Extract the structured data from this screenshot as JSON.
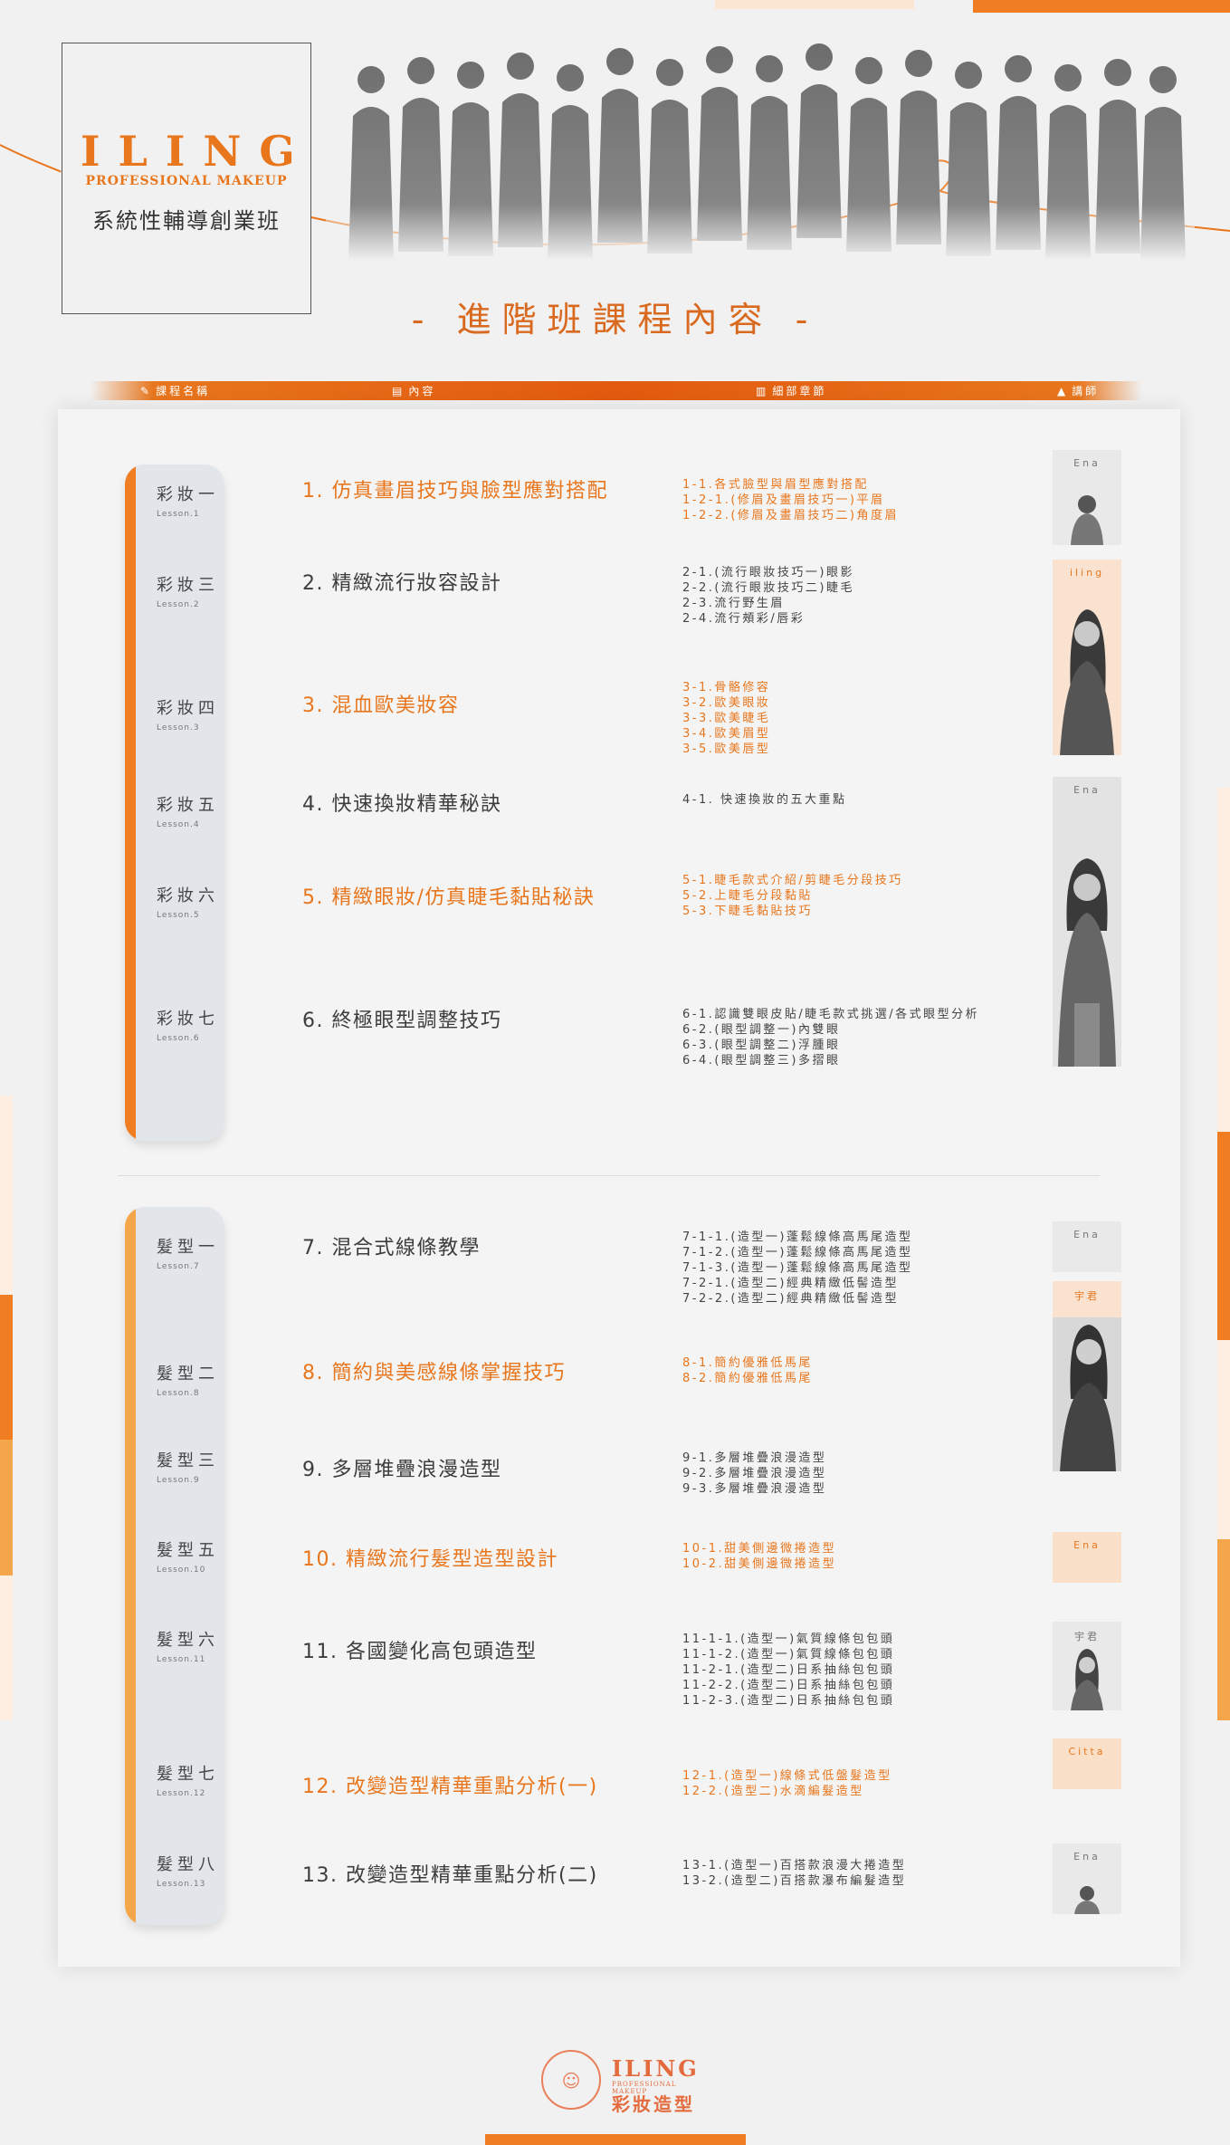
{
  "colors": {
    "accent": "#e8761d",
    "accent_light": "#f5a64a",
    "pill": "#e2e5ea"
  },
  "brand": {
    "name": "ILING",
    "tagline": "PROFESSIONAL MAKEUP",
    "course_line": "系統性輔導創業班"
  },
  "section_title": "- 進階班課程內容 -",
  "header": {
    "col_name": "課程名稱",
    "col_content": "內容",
    "col_chapters": "細部章節",
    "col_teacher": "講師"
  },
  "makeup": [
    {
      "lesson": "彩妝一",
      "lesson_en": "Lesson.1",
      "title": "1. 仿真畫眉技巧與臉型應對搭配",
      "highlight": true,
      "details": [
        "1-1.各式臉型與眉型應對搭配",
        "1-2-1.(修眉及畫眉技巧一)平眉",
        "1-2-2.(修眉及畫眉技巧二)角度眉"
      ]
    },
    {
      "lesson": "彩妝三",
      "lesson_en": "Lesson.2",
      "title": "2. 精緻流行妝容設計",
      "highlight": false,
      "details": [
        "2-1.(流行眼妝技巧一)眼影",
        "2-2.(流行眼妝技巧二)睫毛",
        "2-3.流行野生眉",
        "2-4.流行頰彩/唇彩"
      ]
    },
    {
      "lesson": "彩妝四",
      "lesson_en": "Lesson.3",
      "title": "3. 混血歐美妝容",
      "highlight": true,
      "details": [
        "3-1.骨骼修容",
        "3-2.歐美眼妝",
        "3-3.歐美睫毛",
        "3-4.歐美眉型",
        "3-5.歐美唇型"
      ]
    },
    {
      "lesson": "彩妝五",
      "lesson_en": "Lesson.4",
      "title": "4. 快速換妝精華秘訣",
      "highlight": false,
      "details": [
        "4-1. 快速換妝的五大重點"
      ]
    },
    {
      "lesson": "彩妝六",
      "lesson_en": "Lesson.5",
      "title": "5. 精緻眼妝/仿真睫毛黏貼秘訣",
      "highlight": true,
      "details": [
        "5-1.睫毛款式介紹/剪睫毛分段技巧",
        "5-2.上睫毛分段黏貼",
        "5-3.下睫毛黏貼技巧"
      ]
    },
    {
      "lesson": "彩妝七",
      "lesson_en": "Lesson.6",
      "title": "6. 終極眼型調整技巧",
      "highlight": false,
      "details": [
        "6-1.認識雙眼皮貼/睫毛款式挑選/各式眼型分析",
        "6-2.(眼型調整一)內雙眼",
        "6-3.(眼型調整二)浮腫眼",
        "6-4.(眼型調整三)多摺眼"
      ]
    }
  ],
  "hair": [
    {
      "lesson": "髮型一",
      "lesson_en": "Lesson.7",
      "title": "7. 混合式線條教學",
      "highlight": false,
      "details": [
        "7-1-1.(造型一)蓬鬆線條高馬尾造型",
        "7-1-2.(造型一)蓬鬆線條高馬尾造型",
        "7-1-3.(造型一)蓬鬆線條高馬尾造型",
        "7-2-1.(造型二)經典精緻低髻造型",
        "7-2-2.(造型二)經典精緻低髻造型"
      ]
    },
    {
      "lesson": "髮型二",
      "lesson_en": "Lesson.8",
      "title": "8. 簡約與美感線條掌握技巧",
      "highlight": true,
      "details": [
        "8-1.簡約優雅低馬尾",
        "8-2.簡約優雅低馬尾"
      ]
    },
    {
      "lesson": "髮型三",
      "lesson_en": "Lesson.9",
      "title": "9. 多層堆疊浪漫造型",
      "highlight": false,
      "details": [
        "9-1.多層堆疊浪漫造型",
        "9-2.多層堆疊浪漫造型",
        "9-3.多層堆疊浪漫造型"
      ]
    },
    {
      "lesson": "髮型五",
      "lesson_en": "Lesson.10",
      "title": "10. 精緻流行髮型造型設計",
      "highlight": true,
      "details": [
        "10-1.甜美側邊微捲造型",
        "10-2.甜美側邊微捲造型"
      ]
    },
    {
      "lesson": "髮型六",
      "lesson_en": "Lesson.11",
      "title": "11. 各國變化高包頭造型",
      "highlight": false,
      "details": [
        "11-1-1.(造型一)氣質線條包包頭",
        "11-1-2.(造型一)氣質線條包包頭",
        "11-2-1.(造型二)日系抽絲包包頭",
        "11-2-2.(造型二)日系抽絲包包頭",
        "11-2-3.(造型二)日系抽絲包包頭"
      ]
    },
    {
      "lesson": "髮型七",
      "lesson_en": "Lesson.12",
      "title": "12. 改變造型精華重點分析(一)",
      "highlight": true,
      "details": [
        "12-1.(造型一)線條式低盤髮造型",
        "12-2.(造型二)水滴編髮造型"
      ]
    },
    {
      "lesson": "髮型八",
      "lesson_en": "Lesson.13",
      "title": "13. 改變造型精華重點分析(二)",
      "highlight": false,
      "details": [
        "13-1.(造型一)百搭款浪漫大捲造型",
        "13-2.(造型二)百搭款瀑布編髮造型"
      ]
    }
  ],
  "teachers": [
    {
      "name": "Ena",
      "highlight": false
    },
    {
      "name": "iling",
      "highlight": true
    },
    {
      "name": "Ena",
      "highlight": false
    },
    {
      "name": "Ena",
      "highlight": false
    },
    {
      "name": "宇君",
      "highlight": true
    },
    {
      "name": "Ena",
      "highlight": true
    },
    {
      "name": "宇君",
      "highlight": false
    },
    {
      "name": "Citta",
      "highlight": true
    },
    {
      "name": "Ena",
      "highlight": false
    }
  ],
  "footer_logo": {
    "name": "ILING",
    "sub": "PROFESSIONAL MAKEUP",
    "cn": "彩妝造型"
  }
}
